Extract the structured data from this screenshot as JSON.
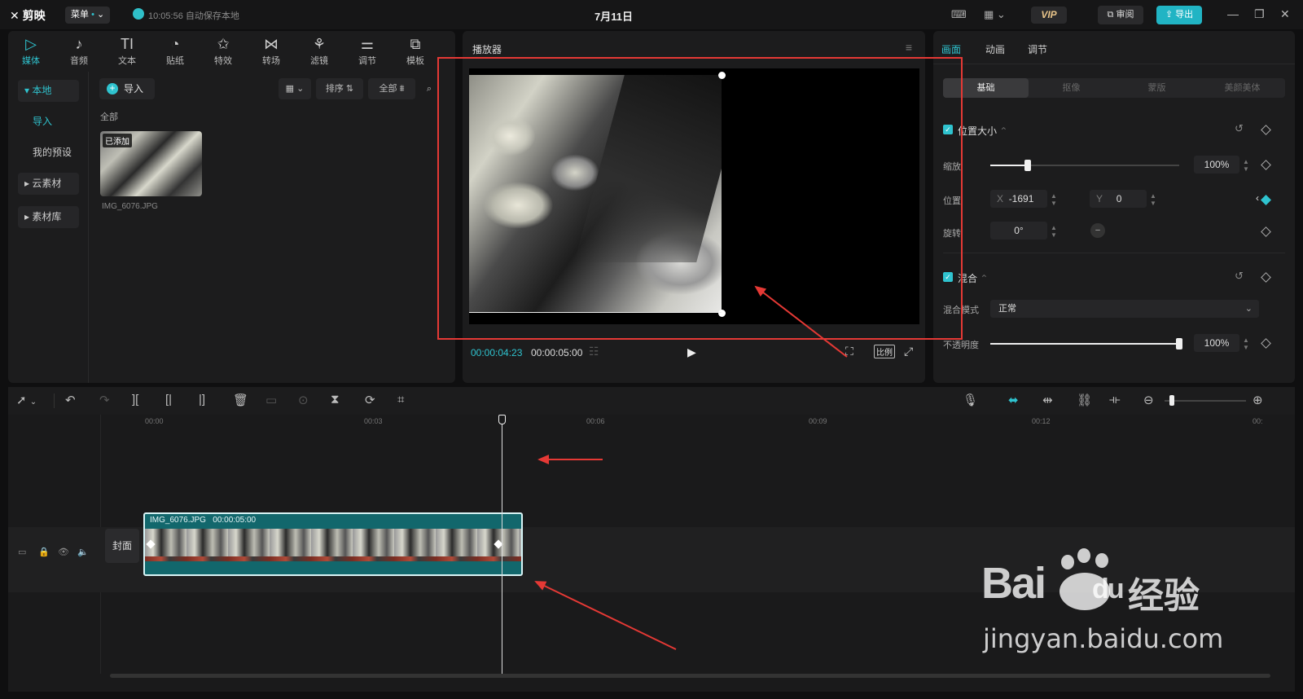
{
  "app": {
    "logo": "剪映",
    "menu_label": "菜单",
    "autosave": "10:05:56 自动保存本地",
    "title": "7月11日",
    "vip": "VIP",
    "review": "审阅",
    "export": "导出"
  },
  "tool_tabs": [
    {
      "label": "媒体",
      "icon": "▷"
    },
    {
      "label": "音频",
      "icon": "♪"
    },
    {
      "label": "文本",
      "icon": "TI"
    },
    {
      "label": "贴纸",
      "icon": "◔"
    },
    {
      "label": "特效",
      "icon": "✩"
    },
    {
      "label": "转场",
      "icon": "⋈"
    },
    {
      "label": "滤镜",
      "icon": "⚘"
    },
    {
      "label": "调节",
      "icon": "⚌"
    },
    {
      "label": "模板",
      "icon": "⧉"
    }
  ],
  "media_sidebar": {
    "local": "本地",
    "import": "导入",
    "presets": "我的预设",
    "cloud": "云素材",
    "library": "素材库"
  },
  "media": {
    "import_btn": "导入",
    "sort": "排序",
    "filter_all": "全部",
    "section_all": "全部",
    "item_badge": "已添加",
    "item_name": "IMG_6076.JPG"
  },
  "player": {
    "title": "播放器",
    "time_current": "00:00:04:23",
    "time_total": "00:00:05:00",
    "ratio": "比例"
  },
  "attr": {
    "tabs": [
      "画面",
      "动画",
      "调节"
    ],
    "subtabs": [
      "基础",
      "抠像",
      "蒙版",
      "美颜美体"
    ],
    "section_position": "位置大小",
    "scale_label": "缩放",
    "scale_value": "100%",
    "scale_level": 0.2,
    "position_label": "位置",
    "x_label": "X",
    "x_value": "-1691",
    "y_label": "Y",
    "y_value": "0",
    "rotate_label": "旋转",
    "rotate_value": "0°",
    "section_blend": "混合",
    "blend_mode_label": "混合模式",
    "blend_mode_value": "正常",
    "opacity_label": "不透明度",
    "opacity_value": "100%",
    "opacity_level": 1.0
  },
  "timeline": {
    "ticks": [
      "00:00",
      "00:03",
      "00:06",
      "00:09",
      "00:12",
      "00:"
    ],
    "cover_label": "封面",
    "clip_label": "IMG_6076.JPG",
    "clip_duration": "00:00:05:00"
  },
  "watermark": {
    "brand": "Bai",
    "du": "du",
    "jingyan": "经验",
    "url": "jingyan.baidu.com"
  },
  "colors": {
    "accent": "#2fc3cf",
    "annotation_red": "#e53935",
    "clip_bg": "#12676c"
  }
}
